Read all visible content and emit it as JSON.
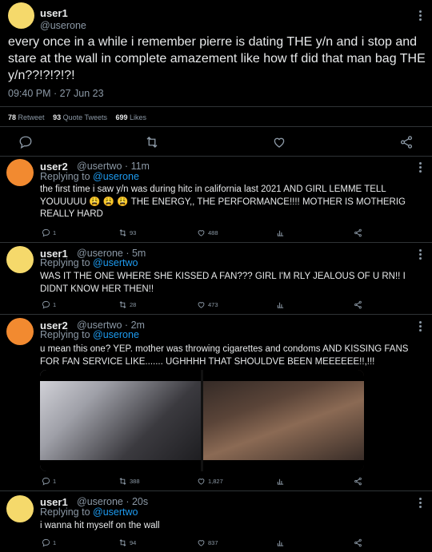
{
  "main_tweet": {
    "name": "user1",
    "handle": "@userone",
    "text": "every once in a while i remember pierre is dating THE y/n and i stop and stare at the wall in complete amazement like how tf did that man bag THE y/n??!?!?!?!",
    "timestamp": "09:40 PM · 27 Jun 23",
    "retweets": "78",
    "retweets_label": "Retweet",
    "quotes": "93",
    "quotes_label": "Quote Tweets",
    "likes": "699",
    "likes_label": "Likes",
    "avatar_color": "#f5d96b"
  },
  "replies": [
    {
      "name": "user2",
      "handle_time": "@usertwo · 11m",
      "replying_label": "Replying to",
      "replying_to": "@userone",
      "text": "the first time i saw y/n was during hitc in california last 2021 AND GIRL LEMME TELL YOUUUUU 😩 😩 😩  THE ENERGY,, THE PERFORMANCE!!!! MOTHER IS MOTHERIG REALLY HARD",
      "replies": "1",
      "retweets": "93",
      "likes": "488",
      "avatar_color": "#f28a30"
    },
    {
      "name": "user1",
      "handle_time": "@userone · 5m",
      "replying_label": "Replying to",
      "replying_to": "@usertwo",
      "text": "WAS IT THE ONE WHERE SHE KISSED A FAN??? GIRL I'M RLY JEALOUS OF U RN!! I DIDNT KNOW HER THEN!!",
      "replies": "1",
      "retweets": "28",
      "likes": "473",
      "avatar_color": "#f5d96b"
    },
    {
      "name": "user2",
      "handle_time": "@usertwo · 2m",
      "replying_label": "Replying to",
      "replying_to": "@userone",
      "text": "u mean this one? YEP. mother was throwing cigarettes and condoms AND KISSING FANS FOR FAN SERVICE LIKE....... UGHHHH THAT SHOULDVE BEEN MEEEEEE!!,!!!",
      "replies": "1",
      "retweets": "388",
      "likes": "1,827",
      "avatar_color": "#f28a30"
    },
    {
      "name": "user1",
      "handle_time": "@userone · 20s",
      "replying_label": "Replying to",
      "replying_to": "@usertwo",
      "text": "i wanna hit myself on the wall",
      "replies": "1",
      "retweets": "94",
      "likes": "837",
      "avatar_color": "#f5d96b"
    }
  ],
  "colors": {
    "background": "#000000",
    "text": "#e7e9ea",
    "muted": "#8b98a5",
    "link": "#1d9bf0",
    "divider": "#2f3336"
  }
}
